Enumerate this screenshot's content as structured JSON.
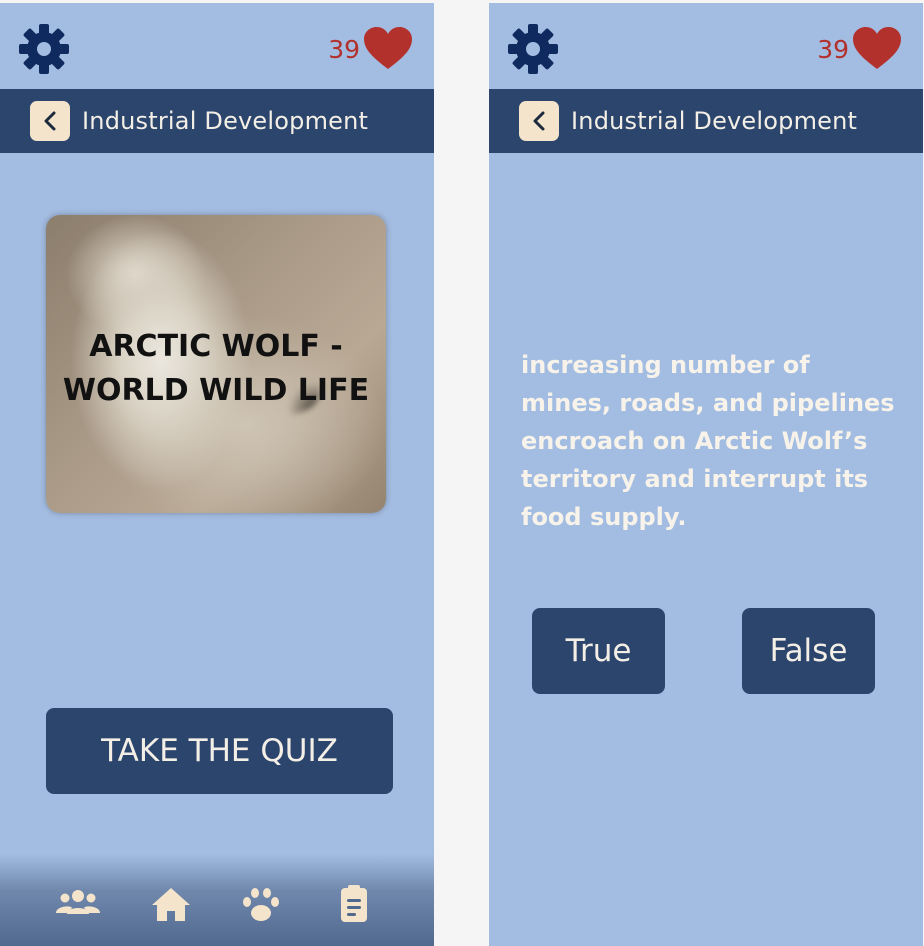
{
  "lives": {
    "count": "39"
  },
  "screens": [
    {
      "nav_title": "Industrial Development",
      "hero": {
        "title_line1": "ARCTIC WOLF -",
        "title_line2": "WORLD WILD LIFE"
      },
      "quiz_button": "TAKE THE QUIZ",
      "bottom_nav": [
        "community-icon",
        "home-icon",
        "paw-icon",
        "clipboard-icon"
      ]
    },
    {
      "nav_title": "Industrial Development",
      "question": "increasing number of mines, roads, and pipelines encroach on Arctic Wolf’s territory and interrupt its food supply.",
      "answers": {
        "true_label": "True",
        "false_label": "False"
      }
    }
  ],
  "colors": {
    "background": "#a3bce1",
    "navbar": "#2c456d",
    "gear": "#0e2a5e",
    "heart": "#b3312c",
    "back_button": "#f5e4cc",
    "text_light": "#f3efe6"
  }
}
